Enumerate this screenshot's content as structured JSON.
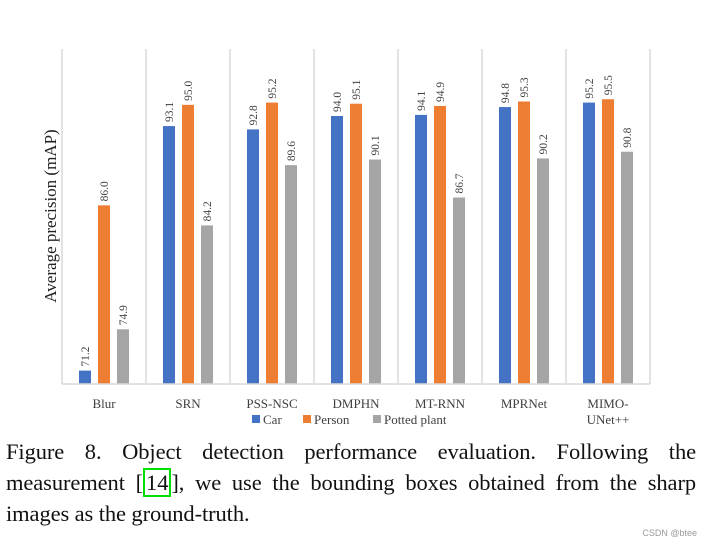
{
  "chart_data": {
    "type": "bar",
    "title": "",
    "xlabel": "",
    "ylabel": "Average precision (mAP)",
    "ylim": [
      70,
      100
    ],
    "grid": "vertical category separators",
    "legend_position": "bottom-center",
    "categories": [
      "Blur",
      "SRN",
      "PSS-NSC",
      "DMPHN",
      "MT-RNN",
      "MPRNet",
      "MIMO-UNet++"
    ],
    "category_label_lines": [
      [
        "Blur"
      ],
      [
        "SRN"
      ],
      [
        "PSS-NSC"
      ],
      [
        "DMPHN"
      ],
      [
        "MT-RNN"
      ],
      [
        "MPRNet"
      ],
      [
        "MIMO-",
        "UNet++"
      ]
    ],
    "series": [
      {
        "name": "Car",
        "color": "#4472c4",
        "values": [
          71.2,
          93.1,
          92.8,
          94.0,
          94.1,
          94.8,
          95.2
        ],
        "labels": [
          "71.2",
          "93.1",
          "92.8",
          "94.0",
          "94.1",
          "94.8",
          "95.2"
        ]
      },
      {
        "name": "Person",
        "color": "#ed7d31",
        "values": [
          86.0,
          95.0,
          95.2,
          95.1,
          94.9,
          95.3,
          95.5
        ],
        "labels": [
          "86.0",
          "95.0",
          "95.2",
          "95.1",
          "94.9",
          "95.3",
          "95.5"
        ]
      },
      {
        "name": "Potted plant",
        "color": "#a5a5a5",
        "values": [
          74.9,
          84.2,
          89.6,
          90.1,
          86.7,
          90.2,
          90.8
        ],
        "labels": [
          "74.9",
          "84.2",
          "89.6",
          "90.1",
          "86.7",
          "90.2",
          "90.8"
        ]
      }
    ]
  },
  "caption": {
    "prefix": "Figure 8. Object detection performance evaluation. Following the measurement [",
    "ref": "14",
    "suffix": "], we use the bounding boxes obtained from the sharp images as the ground-truth."
  },
  "watermark": "CSDN @btee"
}
